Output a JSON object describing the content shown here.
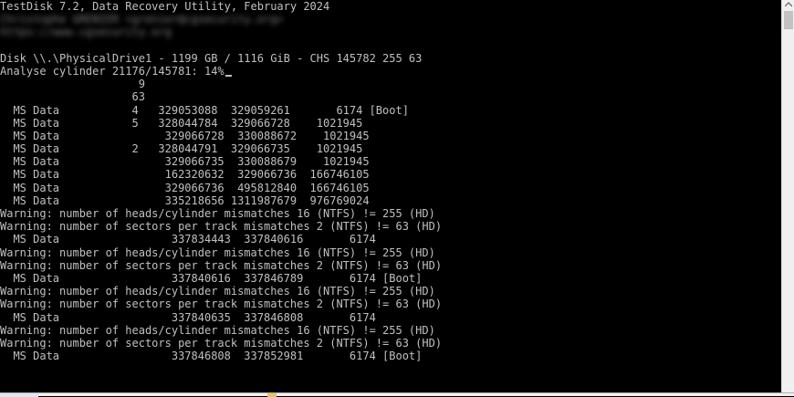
{
  "terminal": {
    "title_line": "TestDisk 7.2, Data Recovery Utility, February 2024",
    "blurred_line_1": "Christophe GRENIER <grenier@cgsecurity.org>",
    "blurred_line_2": "https://www.cgsecurity.org",
    "disk_line": "Disk \\\\.\\PhysicalDrive1 - 1199 GB / 1116 GiB - CHS 145782 255 63",
    "analyse_line": "Analyse cylinder 21176/145781: 14%",
    "lines": [
      "                     9",
      "                    63",
      "  MS Data           4   329053088  329059261       6174 [Boot]",
      "  MS Data           5   328044784  329066728    1021945",
      "  MS Data                329066728  330088672    1021945",
      "  MS Data           2   328044791  329066735    1021945",
      "  MS Data                329066735  330088679    1021945",
      "  MS Data                162320632  329066736  166746105",
      "  MS Data                329066736  495812840  166746105",
      "  MS Data                335218656 1311987679  976769024",
      "Warning: number of heads/cylinder mismatches 16 (NTFS) != 255 (HD)",
      "Warning: number of sectors per track mismatches 2 (NTFS) != 63 (HD)",
      "  MS Data                 337834443  337840616       6174",
      "Warning: number of heads/cylinder mismatches 16 (NTFS) != 255 (HD)",
      "Warning: number of sectors per track mismatches 2 (NTFS) != 63 (HD)",
      "  MS Data                 337840616  337846789       6174 [Boot]",
      "Warning: number of heads/cylinder mismatches 16 (NTFS) != 255 (HD)",
      "Warning: number of sectors per track mismatches 2 (NTFS) != 63 (HD)",
      "  MS Data                 337840635  337846808       6174",
      "Warning: number of heads/cylinder mismatches 16 (NTFS) != 255 (HD)",
      "Warning: number of sectors per track mismatches 2 (NTFS) != 63 (HD)",
      "  MS Data                 337846808  337852981       6174 [Boot]"
    ]
  },
  "colors": {
    "background": "#000000",
    "text": "#c0c0c0",
    "scrollbar": "#f0f0f0"
  }
}
